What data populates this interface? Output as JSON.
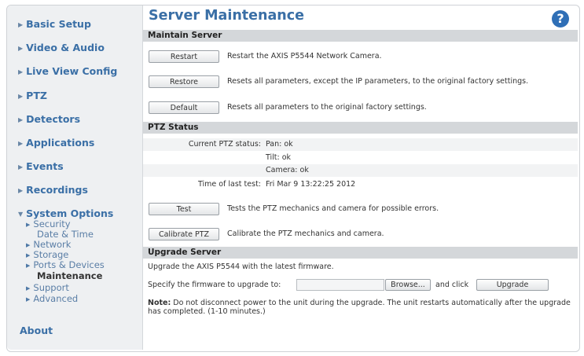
{
  "sidebar": {
    "items": [
      {
        "label": "Basic Setup"
      },
      {
        "label": "Video & Audio"
      },
      {
        "label": "Live View Config"
      },
      {
        "label": "PTZ"
      },
      {
        "label": "Detectors"
      },
      {
        "label": "Applications"
      },
      {
        "label": "Events"
      },
      {
        "label": "Recordings"
      },
      {
        "label": "System Options"
      }
    ],
    "system_options_sub": [
      {
        "label": "Security"
      },
      {
        "label": "Date & Time"
      },
      {
        "label": "Network"
      },
      {
        "label": "Storage"
      },
      {
        "label": "Ports & Devices"
      },
      {
        "label": "Maintenance"
      },
      {
        "label": "Support"
      },
      {
        "label": "Advanced"
      }
    ],
    "about": "About"
  },
  "page": {
    "title": "Server Maintenance",
    "help_icon": "?"
  },
  "maintain": {
    "header": "Maintain Server",
    "restart_btn": "Restart",
    "restart_desc": "Restart the AXIS P5544 Network Camera.",
    "restore_btn": "Restore",
    "restore_desc": "Resets all parameters, except the IP parameters, to the original factory settings.",
    "default_btn": "Default",
    "default_desc": "Resets all parameters to the original factory settings."
  },
  "ptz": {
    "header": "PTZ Status",
    "current_label": "Current PTZ status:",
    "pan": "Pan: ok",
    "tilt": "Tilt: ok",
    "camera": "Camera: ok",
    "time_label": "Time of last test:",
    "time_value": "Fri Mar 9 13:22:25 2012",
    "test_btn": "Test",
    "test_desc": "Tests the PTZ mechanics and camera for possible errors.",
    "calibrate_btn": "Calibrate PTZ",
    "calibrate_desc": "Calibrate the PTZ mechanics and camera."
  },
  "upgrade": {
    "header": "Upgrade Server",
    "desc": "Upgrade the AXIS P5544 with the latest firmware.",
    "specify_label": "Specify the firmware to upgrade to:",
    "browse_btn": "Browse...",
    "and_click": "and click",
    "upgrade_btn": "Upgrade",
    "note_label": "Note:",
    "note_text": " Do not disconnect power to the unit during the upgrade. The unit restarts automatically after the upgrade has completed. (1-10 minutes.)"
  }
}
